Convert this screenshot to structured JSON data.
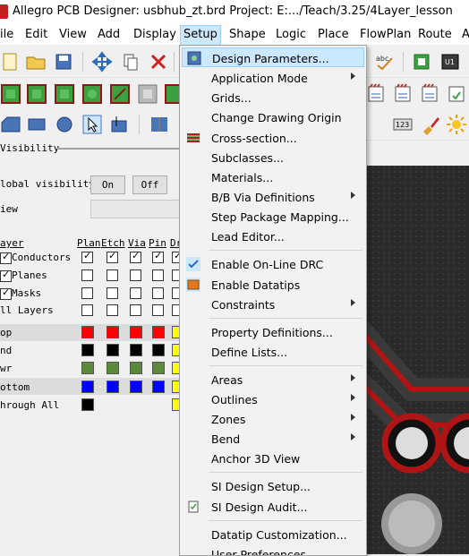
{
  "window": {
    "title": "Allegro PCB Designer: usbhub_zt.brd  Project: E:.../Teach/3.25/4Layer_lesson"
  },
  "menubar": {
    "items": [
      "ile",
      "Edit",
      "View",
      "Add",
      "Display",
      "Setup",
      "Shape",
      "Logic",
      "Place",
      "FlowPlan",
      "Route",
      "A"
    ],
    "active": "Setup"
  },
  "setup_menu": {
    "items": [
      {
        "label": "Design Parameters...",
        "icon": "design-parameters-icon",
        "highlighted": true
      },
      {
        "label": "Application Mode",
        "submenu": true
      },
      {
        "label": "Grids..."
      },
      {
        "label": "Change Drawing Origin"
      },
      {
        "label": "Cross-section...",
        "icon": "cross-section-icon"
      },
      {
        "label": "Subclasses..."
      },
      {
        "label": "Materials..."
      },
      {
        "label": "B/B Via Definitions",
        "submenu": true
      },
      {
        "label": "Step Package Mapping..."
      },
      {
        "label": "Lead Editor..."
      },
      {
        "label": "Enable On-Line DRC",
        "icon": "checkmark-icon"
      },
      {
        "label": "Enable Datatips",
        "icon": "datatips-icon"
      },
      {
        "label": "Constraints",
        "submenu": true
      },
      {
        "label": "Property Definitions..."
      },
      {
        "label": "Define Lists..."
      },
      {
        "label": "Areas",
        "submenu": true
      },
      {
        "label": "Outlines",
        "submenu": true
      },
      {
        "label": "Zones",
        "submenu": true
      },
      {
        "label": "Bend",
        "submenu": true
      },
      {
        "label": "Anchor 3D View"
      },
      {
        "label": "SI Design Setup..."
      },
      {
        "label": "SI Design Audit...",
        "icon": "si-audit-icon"
      },
      {
        "label": "Datatip Customization..."
      },
      {
        "label": "User Preferences..."
      }
    ]
  },
  "visibility": {
    "header": "Visibility",
    "global_label": "lobal visibility",
    "on_label": "On",
    "off_label": "Off",
    "view_label": "iew",
    "layer_header": "ayer",
    "columns": [
      "Plan",
      "Etch",
      "Via",
      "Pin",
      "Dr"
    ],
    "groups": [
      {
        "label": "Conductors"
      },
      {
        "label": "Planes"
      },
      {
        "label": "Masks"
      },
      {
        "label": "ll Layers"
      }
    ],
    "layers": [
      {
        "label": "op",
        "colors": [
          "#ff0000",
          "#ff0000",
          "#ff0000",
          "#ff0000",
          "#ffff00"
        ]
      },
      {
        "label": "nd",
        "colors": [
          "#000000",
          "#000000",
          "#000000",
          "#000000",
          "#ffff00"
        ]
      },
      {
        "label": "wr",
        "colors": [
          "#5a8a3a",
          "#5a8a3a",
          "#5a8a3a",
          "#5a8a3a",
          "#ffff00"
        ]
      },
      {
        "label": "ottom",
        "colors": [
          "#0000ff",
          "#0000ff",
          "#0000ff",
          "#0000ff",
          "#ffff00"
        ]
      },
      {
        "label": "hrough All",
        "colors": [
          "#000000",
          null,
          null,
          null,
          "#ffff00"
        ]
      }
    ]
  },
  "toolbar_icons": {
    "icon_abc": "abc",
    "icon_u1": "U1",
    "icon_123": "123"
  }
}
